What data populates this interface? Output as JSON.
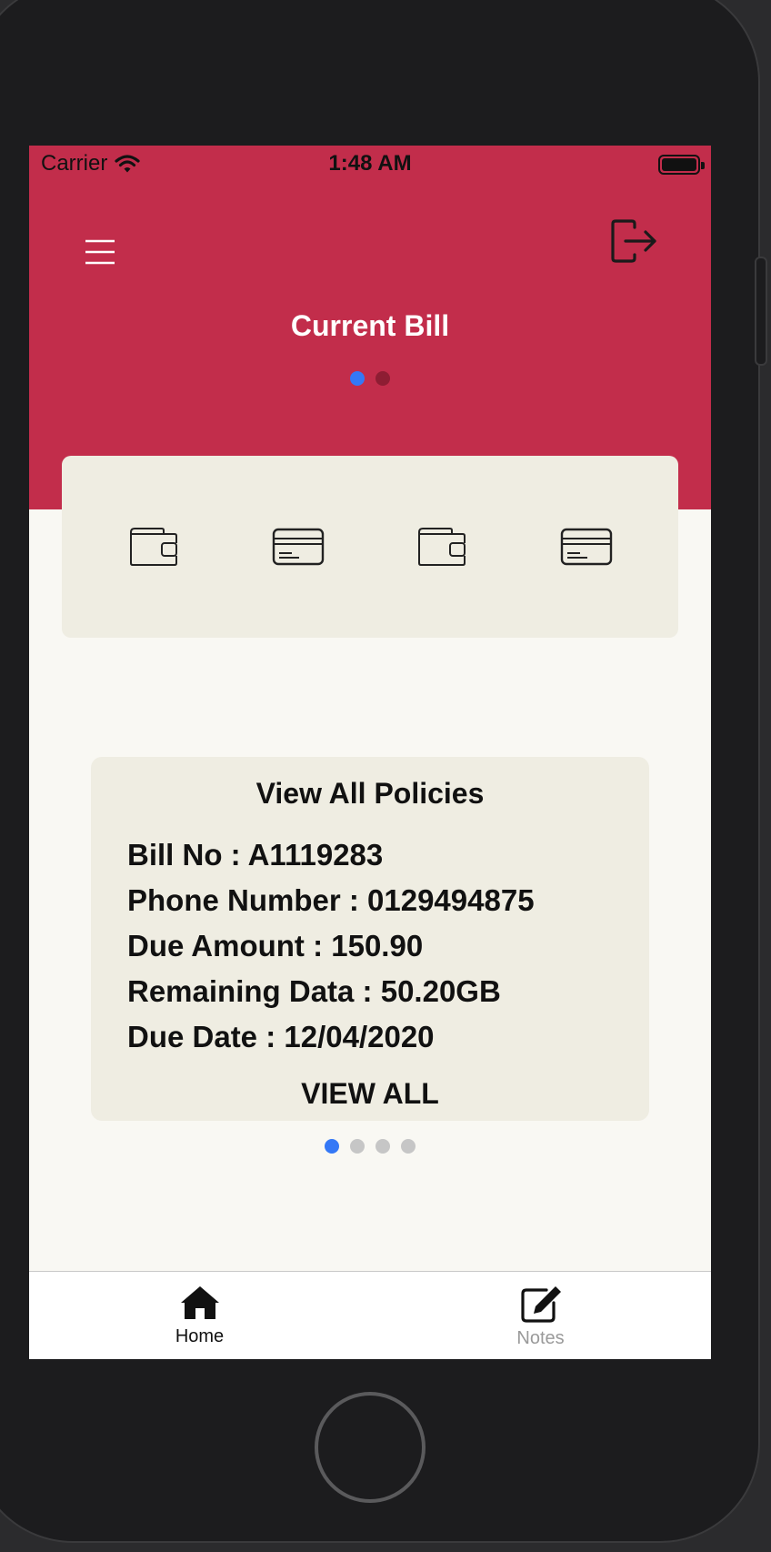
{
  "status_bar": {
    "carrier": "Carrier",
    "time": "1:48 AM"
  },
  "header": {
    "title": "Current Bill",
    "colors": {
      "background": "#c22d4b",
      "active_dot": "#3478f6",
      "inactive_dot": "#8e1d33"
    }
  },
  "quick_actions": [
    {
      "icon": "wallet-icon"
    },
    {
      "icon": "credit-card-icon"
    },
    {
      "icon": "wallet-icon"
    },
    {
      "icon": "credit-card-icon"
    }
  ],
  "policy_card": {
    "title": "View All Policies",
    "lines": [
      "Bill No : A1119283",
      "Phone Number : 0129494875",
      "Due Amount : 150.90",
      "Remaining Data : 50.20GB",
      "Due Date : 12/04/2020"
    ],
    "action_label": "VIEW ALL",
    "page_count": 4,
    "active_page": 1
  },
  "tabbar": {
    "tabs": [
      {
        "label": "Home",
        "icon": "home-icon",
        "active": true
      },
      {
        "label": "Notes",
        "icon": "edit-note-icon",
        "active": false
      }
    ]
  }
}
